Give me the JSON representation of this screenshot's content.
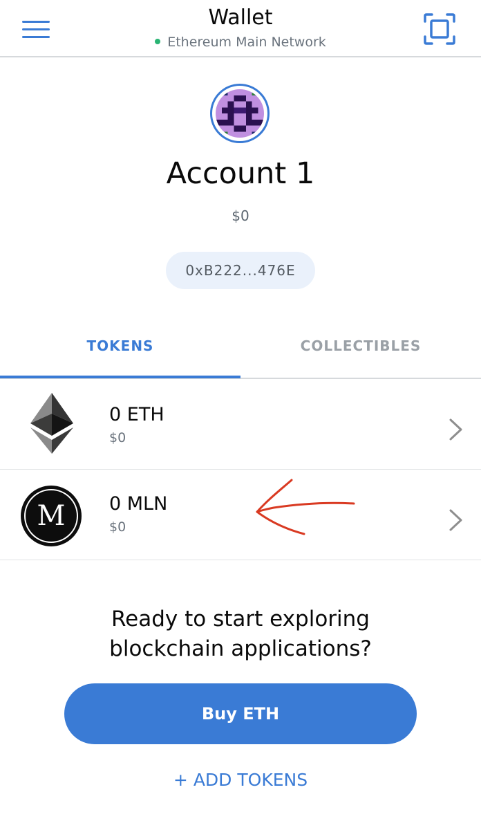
{
  "header": {
    "title": "Wallet",
    "network": "Ethereum Main Network",
    "network_status_color": "#29b473",
    "menu_icon": "hamburger-menu-icon",
    "scan_icon": "qr-scan-icon"
  },
  "account": {
    "name": "Account 1",
    "balance": "$0",
    "address": "0xB222...476E",
    "avatar_icon": "identicon-avatar"
  },
  "tabs": [
    {
      "label": "TOKENS",
      "active": true
    },
    {
      "label": "COLLECTIBLES",
      "active": false
    }
  ],
  "tokens": [
    {
      "amount": "0 ETH",
      "fiat": "$0",
      "icon": "ethereum-icon"
    },
    {
      "amount": "0 MLN",
      "fiat": "$0",
      "icon": "melon-token-icon",
      "icon_letter": "M"
    }
  ],
  "annotation": {
    "icon": "red-hand-drawn-arrow",
    "color": "#d93a22"
  },
  "cta": {
    "prompt_line1": "Ready to start exploring",
    "prompt_line2": "blockchain applications?",
    "buy_button": "Buy ETH",
    "add_tokens": "+ ADD TOKENS"
  },
  "colors": {
    "accent": "#3a7bd5",
    "inactive_tab": "#9aa0a6"
  }
}
